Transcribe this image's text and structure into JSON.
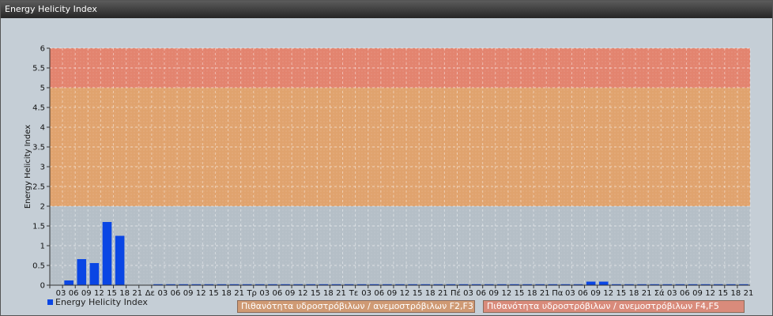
{
  "window": {
    "title": "Energy Helicity Index"
  },
  "chart_data": {
    "type": "bar",
    "title": "",
    "ylabel": "Energy Helicity Index",
    "xlabel": "",
    "ylim": [
      0,
      6
    ],
    "y_ticks": [
      "0",
      "0.5",
      "1",
      "1.5",
      "2",
      "2.5",
      "3",
      "3.5",
      "4",
      "4.5",
      "5",
      "5.5",
      "6"
    ],
    "grid": true,
    "categories": [
      "03",
      "06",
      "09",
      "12",
      "15",
      "18",
      "21",
      "Δε",
      "03",
      "06",
      "09",
      "12",
      "15",
      "18",
      "21",
      "Τρ",
      "03",
      "06",
      "09",
      "12",
      "15",
      "18",
      "21",
      "Τε",
      "03",
      "06",
      "09",
      "12",
      "15",
      "18",
      "21",
      "Πέ",
      "03",
      "06",
      "09",
      "12",
      "15",
      "18",
      "21",
      "Πα",
      "03",
      "06",
      "09",
      "12",
      "15",
      "18",
      "21",
      "Σά",
      "03",
      "06",
      "09",
      "12",
      "15",
      "18",
      "21"
    ],
    "series": [
      {
        "name": "Energy Helicity Index",
        "color": "#0a46e4",
        "values": [
          0,
          0.12,
          0.66,
          0.56,
          1.6,
          1.25,
          0,
          0,
          0.01,
          0.01,
          0.01,
          0.01,
          0.01,
          0.01,
          0.01,
          0.01,
          0.01,
          0.01,
          0.01,
          0.01,
          0.01,
          0.01,
          0.01,
          0.01,
          0.01,
          0.01,
          0.01,
          0.01,
          0.01,
          0.01,
          0.01,
          0.01,
          0.01,
          0.01,
          0.01,
          0.01,
          0.01,
          0.01,
          0.01,
          0.01,
          0.01,
          0.01,
          0.09,
          0.09,
          0.02,
          0.01,
          0.01,
          0.01,
          0.01,
          0.01,
          0.01,
          0.01,
          0.01,
          0.01,
          0.01
        ]
      }
    ],
    "bands": [
      {
        "from": 2,
        "to": 5,
        "color": "#e0a36e",
        "label": "Πιθανότητα υδροστρόβιλων / ανεμοστρόβιλων F2,F3"
      },
      {
        "from": 5,
        "to": 6,
        "color": "#e3846f",
        "label": "Πιθανότητα υδροστρόβιλων / ανεμοστρόβιλων F4,F5"
      }
    ],
    "legend_position": "bottom-left"
  }
}
